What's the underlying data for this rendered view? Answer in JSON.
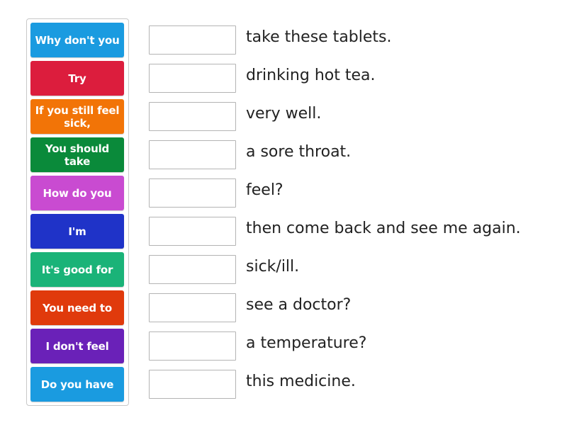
{
  "activity": {
    "type": "match-up",
    "tiles": [
      {
        "label": "Why\ndon't you",
        "color": "#1a9be0"
      },
      {
        "label": "Try",
        "color": "#dc1d3d"
      },
      {
        "label": "If you still feel sick,",
        "color": "#f27407"
      },
      {
        "label": "You should take",
        "color": "#0a8a3a"
      },
      {
        "label": "How do you",
        "color": "#c94bd1"
      },
      {
        "label": "I'm",
        "color": "#1f33c8"
      },
      {
        "label": "It's good for",
        "color": "#1ab378"
      },
      {
        "label": "You need to",
        "color": "#e03a0c"
      },
      {
        "label": "I don't feel",
        "color": "#6a21b8"
      },
      {
        "label": "Do you have",
        "color": "#1a9be0"
      }
    ],
    "phrases": [
      "take these tablets.",
      "drinking hot tea.",
      "very well.",
      "a sore throat.",
      "feel?",
      "then come back and see me again.",
      "sick/ill.",
      "see a doctor?",
      "a temperature?",
      "this medicine."
    ]
  }
}
